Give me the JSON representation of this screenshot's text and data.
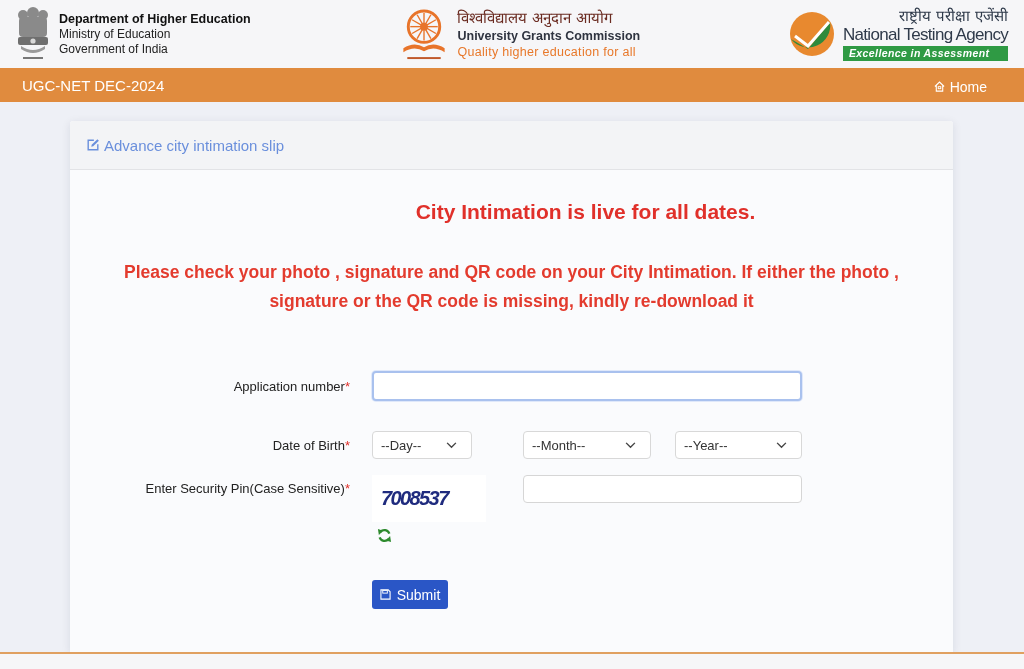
{
  "header": {
    "department": {
      "title": "Department of Higher Education",
      "lines": [
        "Ministry of Education",
        "Government of India"
      ]
    },
    "ugc": {
      "hindi_name": "विश्वविद्यालय अनुदान आयोग",
      "name": "University Grants Commission",
      "tagline": "Quality higher education for all"
    },
    "nta": {
      "hindi_name": "राष्ट्रीय परीक्षा एजेंसी",
      "name": "National Testing Agency",
      "tagline": "Excellence in Assessment"
    }
  },
  "nav_bar": {
    "title": "UGC-NET DEC-2024",
    "links": [
      {
        "label": "Home"
      }
    ]
  },
  "card": {
    "title": "Advance city intimation slip",
    "notice": "City Intimation is live for all dates.",
    "instructions": "Please check your photo , signature and QR code on your City Intimation. If either the photo , signature or the QR code is missing, kindly re-download it",
    "form": {
      "fields": [
        {
          "kind": "text",
          "label": "Application number",
          "required_mark": "*",
          "focused": true
        },
        {
          "kind": "date",
          "label": "Date of Birth",
          "required_mark": "*",
          "focused": false,
          "selects": [
            {
              "value": "--Day--"
            },
            {
              "value": "--Month--"
            },
            {
              "value": "--Year--"
            }
          ]
        },
        {
          "kind": "captcha",
          "label": "Enter Security Pin(Case Sensitive)",
          "required_mark": "*",
          "focused": false,
          "captcha": "7008537"
        }
      ],
      "submit": "Submit"
    }
  }
}
